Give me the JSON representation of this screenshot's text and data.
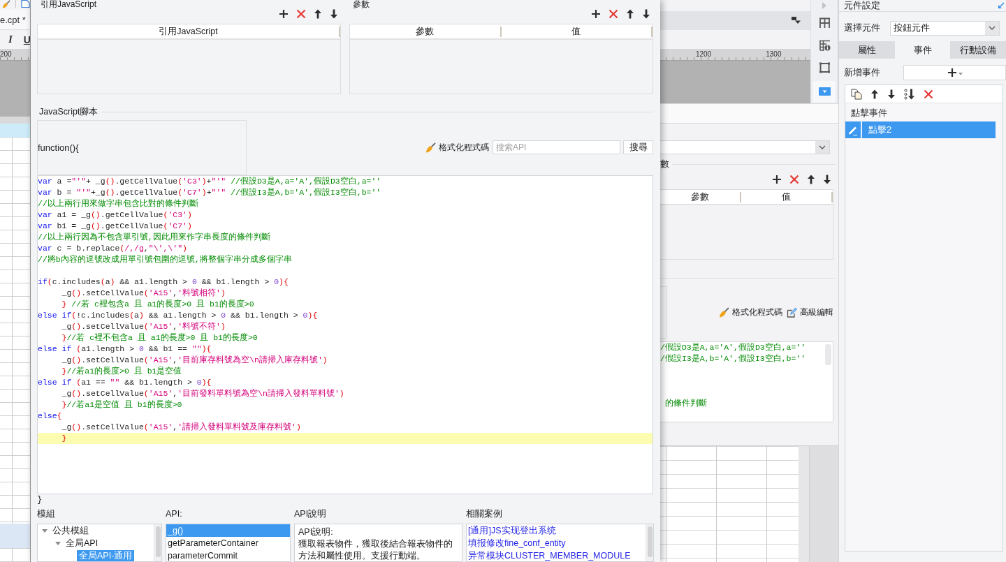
{
  "background_left": {
    "tab": "e.cpt *",
    "format_buttons": [
      {
        "kind": "italic",
        "label": "I"
      },
      {
        "kind": "underline",
        "label": "U"
      }
    ],
    "ruler_labels": [
      "200"
    ]
  },
  "dialog": {
    "groups": [
      {
        "title": "引用JavaScript",
        "columns": [
          "引用JavaScript"
        ]
      },
      {
        "title": "參數",
        "columns": [
          "參數",
          "值"
        ]
      }
    ],
    "script_section": {
      "title": "JavaScript腳本",
      "header": "function(){",
      "format_button": "格式化程式碼",
      "search": {
        "placeholder": "搜索API"
      },
      "search_button": "搜尋",
      "code_blocks": [
        {
          "lines": [
            {
              "highlighted": false,
              "tokens": [
                {
                  "kind": "keyword",
                  "text": "var"
                },
                {
                  "kind": "plain",
                  "text": " a ="
                },
                {
                  "kind": "string",
                  "text": "\"'\""
                },
                {
                  "kind": "plain",
                  "text": "+ _g"
                },
                {
                  "kind": "bracket",
                  "text": "()"
                },
                {
                  "kind": "plain",
                  "text": ".getCellValue"
                },
                {
                  "kind": "bracket",
                  "text": "("
                },
                {
                  "kind": "string",
                  "text": "'C3'"
                },
                {
                  "kind": "bracket",
                  "text": ")"
                },
                {
                  "kind": "plain",
                  "text": "+"
                },
                {
                  "kind": "string",
                  "text": "\"'\""
                },
                {
                  "kind": "comment",
                  "text": " //假設D3是A,a='A',假設D3空白,a=''"
                }
              ]
            },
            {
              "highlighted": false,
              "tokens": [
                {
                  "kind": "keyword",
                  "text": "var"
                },
                {
                  "kind": "plain",
                  "text": " b = "
                },
                {
                  "kind": "string",
                  "text": "\"'\""
                },
                {
                  "kind": "plain",
                  "text": "+_g"
                },
                {
                  "kind": "bracket",
                  "text": "()"
                },
                {
                  "kind": "plain",
                  "text": ".getCellValue"
                },
                {
                  "kind": "bracket",
                  "text": "("
                },
                {
                  "kind": "string",
                  "text": "'C7'"
                },
                {
                  "kind": "bracket",
                  "text": ")"
                },
                {
                  "kind": "plain",
                  "text": "+"
                },
                {
                  "kind": "string",
                  "text": "\"'\""
                },
                {
                  "kind": "comment",
                  "text": " //假設I3是A,b='A',假設I3空白,b=''"
                }
              ]
            },
            {
              "highlighted": false,
              "tokens": [
                {
                  "kind": "comment",
                  "text": "//以上兩行用來做字串包含比對的條件判斷"
                }
              ]
            },
            {
              "highlighted": false,
              "tokens": [
                {
                  "kind": "keyword",
                  "text": "var"
                },
                {
                  "kind": "plain",
                  "text": " a1 = _g"
                },
                {
                  "kind": "bracket",
                  "text": "()"
                },
                {
                  "kind": "plain",
                  "text": ".getCellValue"
                },
                {
                  "kind": "bracket",
                  "text": "("
                },
                {
                  "kind": "string",
                  "text": "'C3'"
                },
                {
                  "kind": "bracket",
                  "text": ")"
                }
              ]
            },
            {
              "highlighted": false,
              "tokens": [
                {
                  "kind": "keyword",
                  "text": "var"
                },
                {
                  "kind": "plain",
                  "text": " b1 = _g"
                },
                {
                  "kind": "bracket",
                  "text": "()"
                },
                {
                  "kind": "plain",
                  "text": ".getCellValue"
                },
                {
                  "kind": "bracket",
                  "text": "("
                },
                {
                  "kind": "string",
                  "text": "'C7'"
                },
                {
                  "kind": "bracket",
                  "text": ")"
                }
              ]
            },
            {
              "highlighted": false,
              "tokens": [
                {
                  "kind": "comment",
                  "text": "//以上兩行因為不包含單引號,因此用來作字串長度的條件判斷"
                }
              ]
            },
            {
              "highlighted": false,
              "tokens": [
                {
                  "kind": "keyword",
                  "text": "var"
                },
                {
                  "kind": "plain",
                  "text": " c = b.replace"
                },
                {
                  "kind": "bracket",
                  "text": "("
                },
                {
                  "kind": "string",
                  "text": "/,/g"
                },
                {
                  "kind": "plain",
                  "text": ","
                },
                {
                  "kind": "string",
                  "text": "\"\\',\\'\""
                },
                {
                  "kind": "bracket",
                  "text": ")"
                }
              ]
            },
            {
              "highlighted": false,
              "tokens": [
                {
                  "kind": "comment",
                  "text": "//將b內容的逗號改成用單引號包圍的逗號,將整個字串分成多個字串"
                }
              ]
            }
          ]
        },
        {
          "lines": [
            {
              "highlighted": false,
              "tokens": [
                {
                  "kind": "keyword",
                  "text": "if"
                },
                {
                  "kind": "bracket",
                  "text": "("
                },
                {
                  "kind": "plain",
                  "text": "c.includes"
                },
                {
                  "kind": "bracket",
                  "text": "("
                },
                {
                  "kind": "plain",
                  "text": "a"
                },
                {
                  "kind": "bracket",
                  "text": ")"
                },
                {
                  "kind": "plain",
                  "text": " && a1.length > "
                },
                {
                  "kind": "number",
                  "text": "0"
                },
                {
                  "kind": "plain",
                  "text": " && b1.length > "
                },
                {
                  "kind": "number",
                  "text": "0"
                },
                {
                  "kind": "bracket",
                  "text": "){"
                }
              ]
            },
            {
              "highlighted": false,
              "tokens": [
                {
                  "kind": "plain",
                  "text": "     _g"
                },
                {
                  "kind": "bracket",
                  "text": "()"
                },
                {
                  "kind": "plain",
                  "text": ".setCellValue"
                },
                {
                  "kind": "bracket",
                  "text": "("
                },
                {
                  "kind": "string",
                  "text": "'A15'"
                },
                {
                  "kind": "plain",
                  "text": ","
                },
                {
                  "kind": "string",
                  "text": "'料號相符'"
                },
                {
                  "kind": "bracket",
                  "text": ")"
                }
              ]
            },
            {
              "highlighted": false,
              "tokens": [
                {
                  "kind": "bracket",
                  "text": "     }"
                },
                {
                  "kind": "comment",
                  "text": " //若 c裡包含a 且 a1的長度>0 且 b1的長度>0"
                }
              ]
            },
            {
              "highlighted": false,
              "tokens": [
                {
                  "kind": "keyword",
                  "text": "else if"
                },
                {
                  "kind": "bracket",
                  "text": "("
                },
                {
                  "kind": "plain",
                  "text": "!c.includes"
                },
                {
                  "kind": "bracket",
                  "text": "("
                },
                {
                  "kind": "plain",
                  "text": "a"
                },
                {
                  "kind": "bracket",
                  "text": ")"
                },
                {
                  "kind": "plain",
                  "text": " && a1.length > "
                },
                {
                  "kind": "number",
                  "text": "0"
                },
                {
                  "kind": "plain",
                  "text": " && b1.length > "
                },
                {
                  "kind": "number",
                  "text": "0"
                },
                {
                  "kind": "bracket",
                  "text": "){"
                }
              ]
            },
            {
              "highlighted": false,
              "tokens": [
                {
                  "kind": "plain",
                  "text": "     _g"
                },
                {
                  "kind": "bracket",
                  "text": "()"
                },
                {
                  "kind": "plain",
                  "text": ".setCellValue"
                },
                {
                  "kind": "bracket",
                  "text": "("
                },
                {
                  "kind": "string",
                  "text": "'A15'"
                },
                {
                  "kind": "plain",
                  "text": ","
                },
                {
                  "kind": "string",
                  "text": "'料號不符'"
                },
                {
                  "kind": "bracket",
                  "text": ")"
                }
              ]
            },
            {
              "highlighted": false,
              "tokens": [
                {
                  "kind": "bracket",
                  "text": "     }"
                },
                {
                  "kind": "comment",
                  "text": "//若 c裡不包含a 且 a1的長度>0 且 b1的長度>0"
                }
              ]
            },
            {
              "highlighted": false,
              "tokens": [
                {
                  "kind": "keyword",
                  "text": "else if"
                },
                {
                  "kind": "bracket",
                  "text": " ("
                },
                {
                  "kind": "plain",
                  "text": "a1.length > "
                },
                {
                  "kind": "number",
                  "text": "0"
                },
                {
                  "kind": "plain",
                  "text": " && b1 == "
                },
                {
                  "kind": "string",
                  "text": "\"\""
                },
                {
                  "kind": "bracket",
                  "text": "){"
                }
              ]
            },
            {
              "highlighted": false,
              "tokens": [
                {
                  "kind": "plain",
                  "text": "     _g"
                },
                {
                  "kind": "bracket",
                  "text": "()"
                },
                {
                  "kind": "plain",
                  "text": ".setCellValue"
                },
                {
                  "kind": "bracket",
                  "text": "("
                },
                {
                  "kind": "string",
                  "text": "'A15'"
                },
                {
                  "kind": "plain",
                  "text": ","
                },
                {
                  "kind": "string",
                  "text": "'目前庫存料號為空\\n請掃入庫存料號'"
                },
                {
                  "kind": "bracket",
                  "text": ")"
                }
              ]
            },
            {
              "highlighted": false,
              "tokens": [
                {
                  "kind": "bracket",
                  "text": "     }"
                },
                {
                  "kind": "comment",
                  "text": "//若a1的長度>0 且 b1是空值"
                }
              ]
            },
            {
              "highlighted": false,
              "tokens": [
                {
                  "kind": "keyword",
                  "text": "else if"
                },
                {
                  "kind": "bracket",
                  "text": " ("
                },
                {
                  "kind": "plain",
                  "text": "a1 == "
                },
                {
                  "kind": "string",
                  "text": "\"\""
                },
                {
                  "kind": "plain",
                  "text": " && b1.length > "
                },
                {
                  "kind": "number",
                  "text": "0"
                },
                {
                  "kind": "bracket",
                  "text": "){"
                }
              ]
            },
            {
              "highlighted": false,
              "tokens": [
                {
                  "kind": "plain",
                  "text": "     _g"
                },
                {
                  "kind": "bracket",
                  "text": "()"
                },
                {
                  "kind": "plain",
                  "text": ".setCellValue"
                },
                {
                  "kind": "bracket",
                  "text": "("
                },
                {
                  "kind": "string",
                  "text": "'A15'"
                },
                {
                  "kind": "plain",
                  "text": ","
                },
                {
                  "kind": "string",
                  "text": "'目前發料單料號為空\\n請掃入發料單料號'"
                },
                {
                  "kind": "bracket",
                  "text": ")"
                }
              ]
            },
            {
              "highlighted": false,
              "tokens": [
                {
                  "kind": "bracket",
                  "text": "     }"
                },
                {
                  "kind": "comment",
                  "text": "//若a1是空值 且 b1的長度>0"
                }
              ]
            },
            {
              "highlighted": false,
              "tokens": [
                {
                  "kind": "keyword",
                  "text": "else"
                },
                {
                  "kind": "bracket",
                  "text": "{"
                }
              ]
            },
            {
              "highlighted": false,
              "tokens": [
                {
                  "kind": "plain",
                  "text": "     _g"
                },
                {
                  "kind": "bracket",
                  "text": "()"
                },
                {
                  "kind": "plain",
                  "text": ".setCellValue"
                },
                {
                  "kind": "bracket",
                  "text": "("
                },
                {
                  "kind": "string",
                  "text": "'A15'"
                },
                {
                  "kind": "plain",
                  "text": ","
                },
                {
                  "kind": "string",
                  "text": "'請掃入發料單料號及庫存料號'"
                },
                {
                  "kind": "bracket",
                  "text": ")"
                }
              ]
            },
            {
              "highlighted": true,
              "tokens": [
                {
                  "kind": "bracket",
                  "text": "     }"
                }
              ]
            }
          ]
        }
      ],
      "footer": "}"
    },
    "api_panel": {
      "modules": {
        "label": "模組",
        "tree": [
          {
            "label": "公共模組",
            "expanded": true,
            "selected": false,
            "children": [
              {
                "label": "全局API",
                "expanded": true,
                "selected": false,
                "children": [
                  {
                    "label": "全局API-通用",
                    "selected": true
                  }
                ]
              }
            ]
          }
        ]
      },
      "api": {
        "label": "API:",
        "items": [
          {
            "label": "_g()",
            "selected": true
          },
          {
            "label": "getParameterContainer",
            "selected": false
          },
          {
            "label": "parameterCommit",
            "selected": false
          }
        ]
      },
      "description": {
        "label": "API說明",
        "heading": "API說明:",
        "text": "獲取報表物件，獲取後結合報表物件的方法和屬性使用。支援行動端。"
      },
      "related": {
        "label": "相關案例",
        "links": [
          "[通用]JS实现登出系统",
          "填报修改fine_conf_entity",
          "异常模块CLUSTER_MEMBER_MODULE"
        ]
      }
    }
  },
  "background_middle": {
    "ruler_labels": [
      "1200",
      "1300"
    ],
    "parameter_label": "數",
    "parameter_columns": [
      "參數",
      "值"
    ],
    "format_button": "格式化程式碼",
    "advanced_edit_button": "高級編輯",
    "code_lines": [
      "/假設D3是A,a='A',假設D3空白,a=''",
      "/假設I3是A,b='A',假設I3空白,b=''",
      "的條件判斷"
    ]
  },
  "properties_panel": {
    "title": "元件設定",
    "select_label": "選擇元件",
    "select_value": "按鈕元件",
    "tabs": [
      {
        "label": "屬性",
        "selected": false
      },
      {
        "label": "事件",
        "selected": true
      },
      {
        "label": "行動設備",
        "selected": false
      }
    ],
    "add_event_label": "新增事件",
    "event_group": "點擊事件",
    "events": [
      {
        "label": "點擊2",
        "selected": true
      }
    ]
  }
}
